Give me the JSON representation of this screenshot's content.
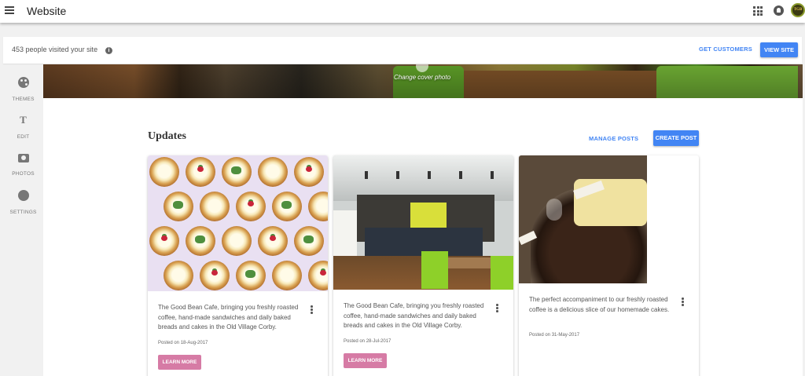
{
  "topbar": {
    "menu_icon": "hamburger-menu-icon",
    "title": "Website",
    "apps_icon": "apps-grid-icon",
    "notifications_icon": "notifications-icon",
    "avatar_text": "TGB"
  },
  "visits_bar": {
    "count_text": "453 people visited your site",
    "info_icon": "i",
    "get_customers_label": "GET CUSTOMERS",
    "view_site_label": "VIEW SITE"
  },
  "sidebar": {
    "items": [
      {
        "label": "THEMES",
        "icon": "palette-icon"
      },
      {
        "label": "EDIT",
        "icon": "text-format-icon"
      },
      {
        "label": "PHOTOS",
        "icon": "add-photo-icon"
      },
      {
        "label": "SETTINGS",
        "icon": "settings-gear-icon"
      }
    ]
  },
  "cover": {
    "change_label": "Change cover photo"
  },
  "updates": {
    "title": "Updates",
    "manage_label": "MANAGE POSTS",
    "create_label": "CREATE POST",
    "posts": [
      {
        "text": "The Good Bean Cafe, bringing you freshly roasted coffee, hand-made sandwiches and daily baked breads and cakes in the Old Village Corby.",
        "date": "Posted on 18-Aug-2017",
        "button": "LEARN MORE"
      },
      {
        "text": "The Good Bean Cafe, bringing you freshly roasted coffee, hand-made sandwiches and daily baked breads and cakes in the Old Village Corby.",
        "date": "Posted on 28-Jul-2017",
        "button": "LEARN MORE"
      },
      {
        "text": "The perfect accompaniment to our freshly roasted coffee is a delicious slice of our homemade cakes.",
        "date": "Posted on 31-May-2017"
      }
    ]
  },
  "colors": {
    "accent": "#4285f4",
    "learn_more": "#d67ba5",
    "rail_background": "#f1f1f1"
  }
}
